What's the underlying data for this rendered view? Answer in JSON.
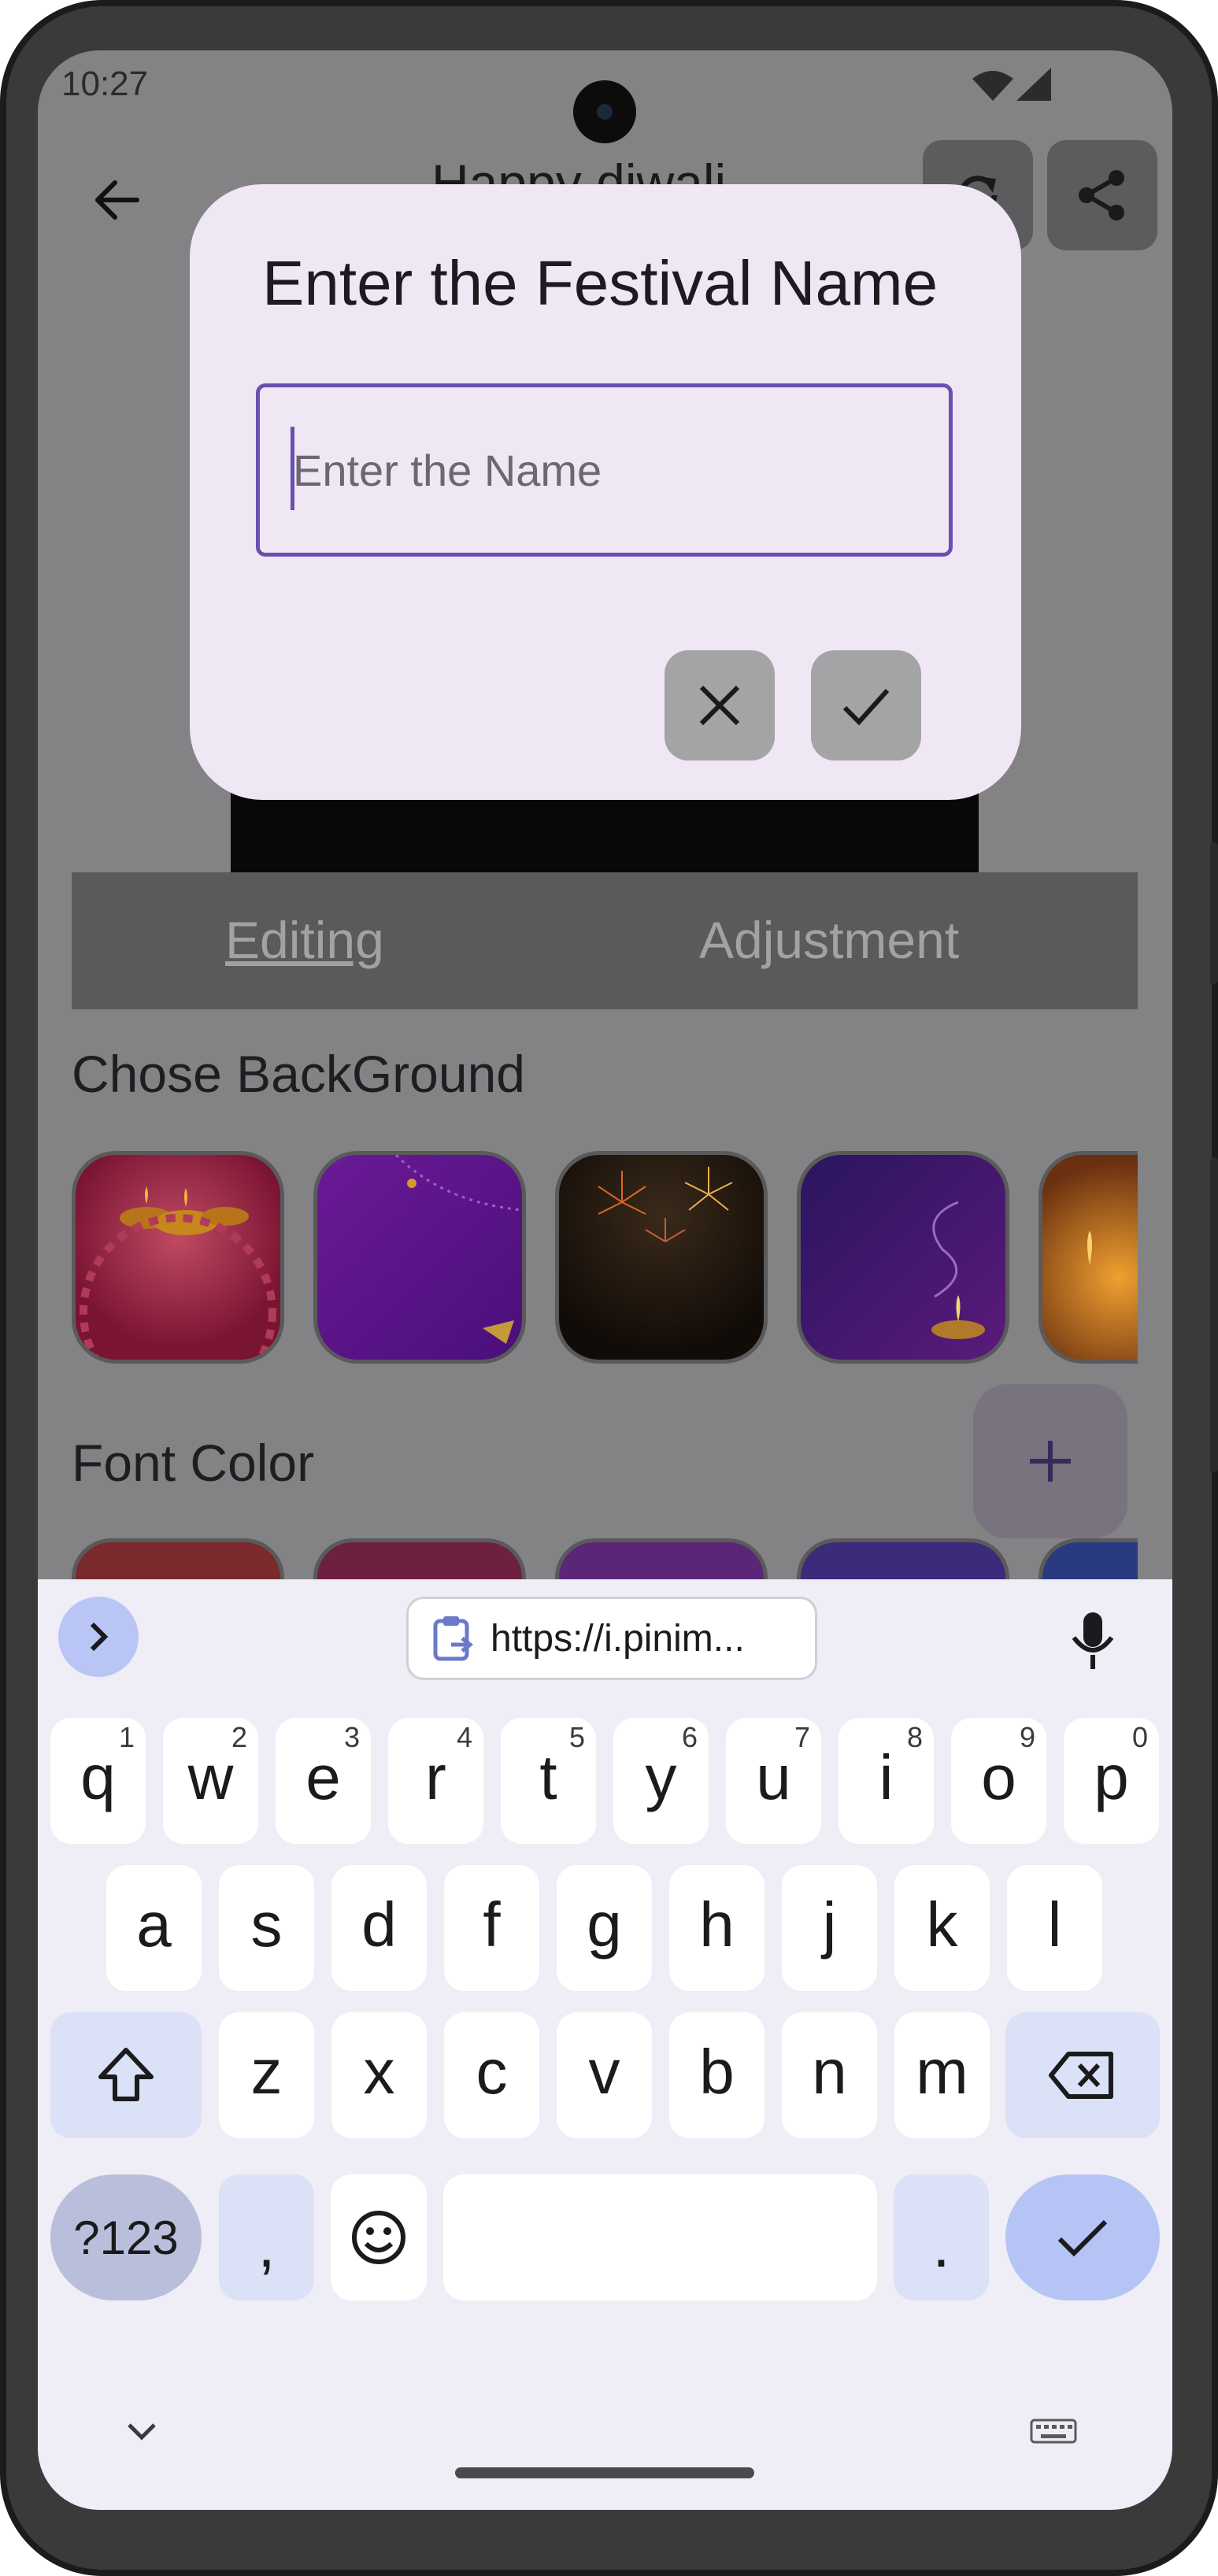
{
  "status_bar": {
    "time": "10:27"
  },
  "app": {
    "title": "Happy diwali",
    "tabs": [
      {
        "label": "Editing",
        "active": true
      },
      {
        "label": "Adjustment",
        "active": false
      }
    ],
    "sections": {
      "background": "Chose BackGround",
      "font_color": "Font Color"
    },
    "fab_label": "+"
  },
  "dialog": {
    "title": "Enter the Festival Name",
    "input": {
      "value": "",
      "placeholder": "Enter the Name"
    },
    "cancel_icon": "close-icon",
    "confirm_icon": "check-icon"
  },
  "keyboard": {
    "clipboard_suggestion": "https://i.pinim...",
    "rows": [
      [
        {
          "k": "q",
          "h": "1"
        },
        {
          "k": "w",
          "h": "2"
        },
        {
          "k": "e",
          "h": "3"
        },
        {
          "k": "r",
          "h": "4"
        },
        {
          "k": "t",
          "h": "5"
        },
        {
          "k": "y",
          "h": "6"
        },
        {
          "k": "u",
          "h": "7"
        },
        {
          "k": "i",
          "h": "8"
        },
        {
          "k": "o",
          "h": "9"
        },
        {
          "k": "p",
          "h": "0"
        }
      ],
      [
        {
          "k": "a"
        },
        {
          "k": "s"
        },
        {
          "k": "d"
        },
        {
          "k": "f"
        },
        {
          "k": "g"
        },
        {
          "k": "h"
        },
        {
          "k": "j"
        },
        {
          "k": "k"
        },
        {
          "k": "l"
        }
      ],
      [
        {
          "k": "z"
        },
        {
          "k": "x"
        },
        {
          "k": "c"
        },
        {
          "k": "v"
        },
        {
          "k": "b"
        },
        {
          "k": "n"
        },
        {
          "k": "m"
        }
      ]
    ],
    "symbols_key": "?123",
    "comma_key": ",",
    "period_key": "."
  },
  "colors": {
    "dialog_bg": "#efe7f3",
    "input_border": "#6a4fb0",
    "scrim": "#838285",
    "keyboard_bg": "#efedf6",
    "enter_key": "#b5c4f5"
  }
}
